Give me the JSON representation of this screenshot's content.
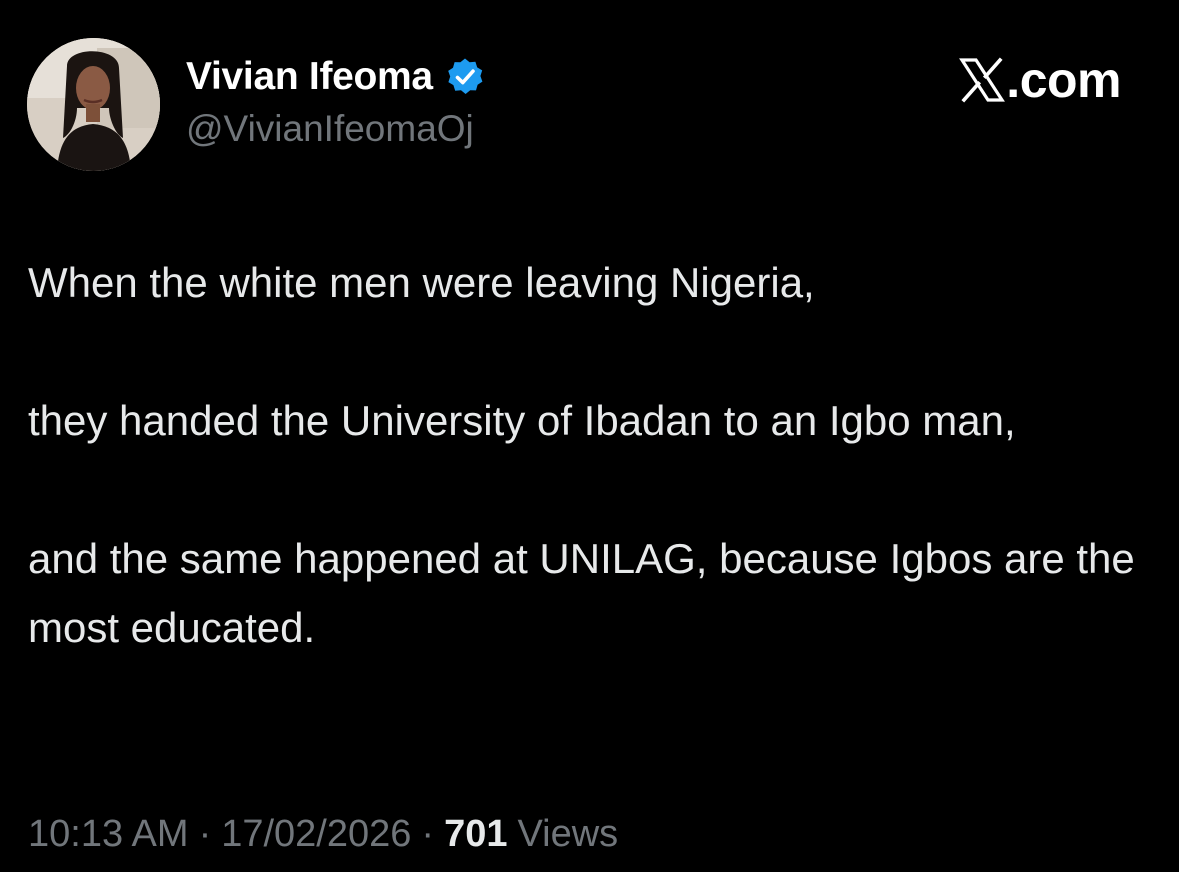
{
  "user": {
    "display_name": "Vivian Ifeoma",
    "handle": "@VivianIfeomaOj",
    "verified_icon": "verified-badge-icon",
    "avatar_icon": "avatar-photo"
  },
  "brand": {
    "logo_icon": "x-logo-icon",
    "text": ".com"
  },
  "tweet": {
    "paragraphs": [
      "When the white men were leaving Nigeria,",
      "they handed the University of Ibadan to an Igbo man,",
      "and the same happened at UNILAG, because Igbos are the most educated."
    ]
  },
  "meta": {
    "time": "10:13 AM",
    "separator": "·",
    "date": "17/02/2026",
    "views_count": "701",
    "views_label": "Views"
  },
  "colors": {
    "background": "#000000",
    "primary_text": "#e7e9ea",
    "secondary_text": "#71767b",
    "verified_blue": "#1d9bf0"
  }
}
